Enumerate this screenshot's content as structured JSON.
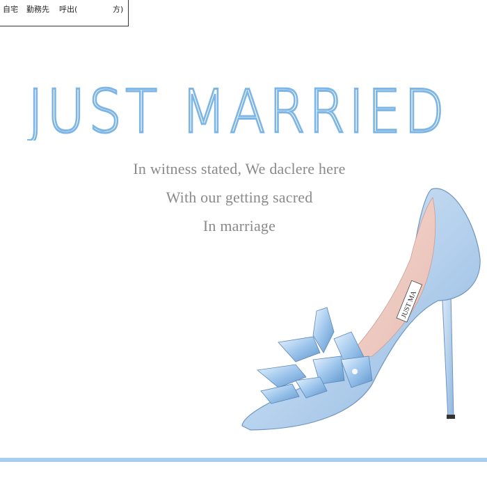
{
  "phone_field": {
    "home": "自宅",
    "work": "勤務先",
    "callout": "呼出(",
    "callout_close": "方)"
  },
  "title": "JUST MARRIED",
  "verse": [
    "In witness stated, We daclere here",
    "With our getting sacred",
    "In marriage"
  ],
  "shoe_label": "JUST MA",
  "colors": {
    "title": "#7db6e6",
    "verse": "#8a8a8a",
    "stripe": "#a9cdee",
    "shoe": "#b8d3ee"
  }
}
